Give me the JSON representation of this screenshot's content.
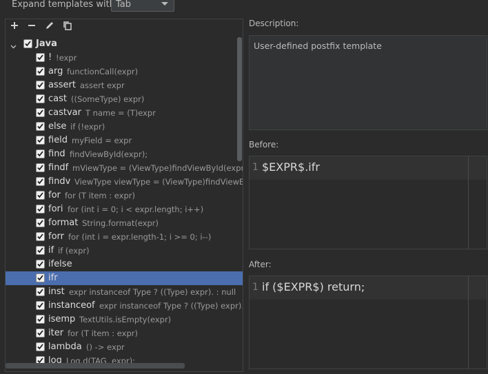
{
  "header": {
    "expand_label": "Expand templates with",
    "expand_value": "Tab"
  },
  "toolbar": {
    "add": "add",
    "remove": "remove",
    "edit": "edit",
    "copy": "copy"
  },
  "tree": {
    "group": {
      "label": "Java",
      "checked": true
    },
    "items": [
      {
        "key": "!",
        "desc": "!expr"
      },
      {
        "key": "arg",
        "desc": "functionCall(expr)"
      },
      {
        "key": "assert",
        "desc": "assert expr"
      },
      {
        "key": "cast",
        "desc": "((SomeType) expr)"
      },
      {
        "key": "castvar",
        "desc": "T name = (T)expr"
      },
      {
        "key": "else",
        "desc": "if (!expr)"
      },
      {
        "key": "field",
        "desc": "myField = expr"
      },
      {
        "key": "find",
        "desc": "findViewById(expr);"
      },
      {
        "key": "findf",
        "desc": "mViewType = (ViewType)findViewById(expr);"
      },
      {
        "key": "findv",
        "desc": "ViewType viewType = (ViewType)findViewById(e"
      },
      {
        "key": "for",
        "desc": "for (T item : expr)"
      },
      {
        "key": "fori",
        "desc": "for (int i = 0; i < expr.length; i++)"
      },
      {
        "key": "format",
        "desc": "String.format(expr)"
      },
      {
        "key": "forr",
        "desc": "for (int i = expr.length-1; i >= 0; i--)"
      },
      {
        "key": "if",
        "desc": "if (expr)"
      },
      {
        "key": "ifelse",
        "desc": ""
      },
      {
        "key": "ifr",
        "desc": "",
        "selected": true
      },
      {
        "key": "inst",
        "desc": "expr instanceof Type ? ((Type) expr). : null"
      },
      {
        "key": "instanceof",
        "desc": "expr instanceof Type ? ((Type) expr). : null"
      },
      {
        "key": "isemp",
        "desc": "TextUtils.isEmpty(expr)"
      },
      {
        "key": "iter",
        "desc": "for (T item : expr)"
      },
      {
        "key": "lambda",
        "desc": "() -> expr"
      },
      {
        "key": "log",
        "desc": "Log.d(TAG, expr);"
      }
    ]
  },
  "description": {
    "label": "Description:",
    "text": "User-defined postfix template"
  },
  "before": {
    "label": "Before:",
    "line_number": "1",
    "code": "$EXPR$.ifr"
  },
  "after": {
    "label": "After:",
    "line_number": "1",
    "code": "if ($EXPR$) return;"
  },
  "colors": {
    "background": "#2b2b2b",
    "selection": "#4b6eaf",
    "editor_line": "#323232"
  }
}
